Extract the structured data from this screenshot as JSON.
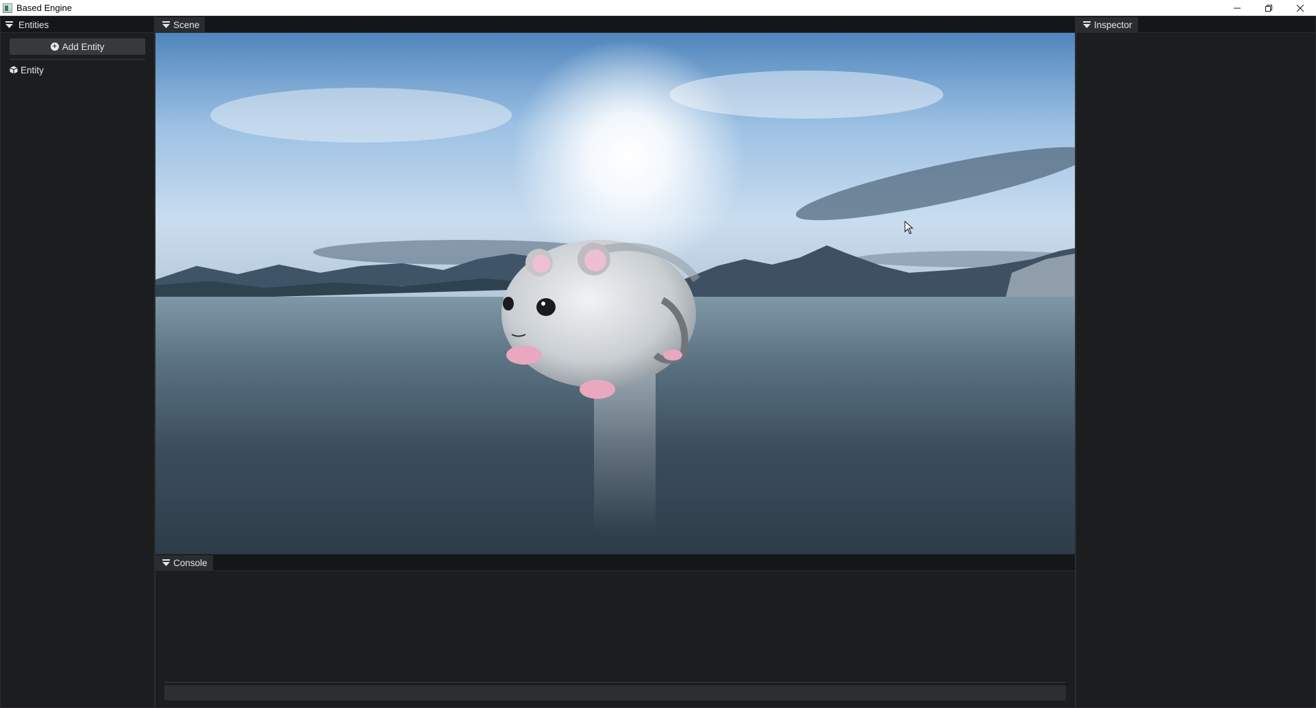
{
  "window": {
    "title": "Based Engine",
    "controls": [
      "minimize-icon",
      "maximize-icon",
      "close-icon"
    ]
  },
  "entities_panel": {
    "title": "Entities",
    "add_button_label": "Add Entity",
    "items": [
      {
        "label": "Entity",
        "icon": "cube-icon"
      }
    ]
  },
  "scene_panel": {
    "title": "Scene",
    "viewport": {
      "description": "3D viewport",
      "object": "hamster-model",
      "environment": "sky-over-lake"
    }
  },
  "console_panel": {
    "title": "Console",
    "input_value": ""
  },
  "inspector_panel": {
    "title": "Inspector"
  },
  "colors": {
    "panel_bg": "#1c1d1f",
    "header_bg": "#151618",
    "tab_bg": "#2a2c30",
    "button_bg": "#37393d"
  }
}
